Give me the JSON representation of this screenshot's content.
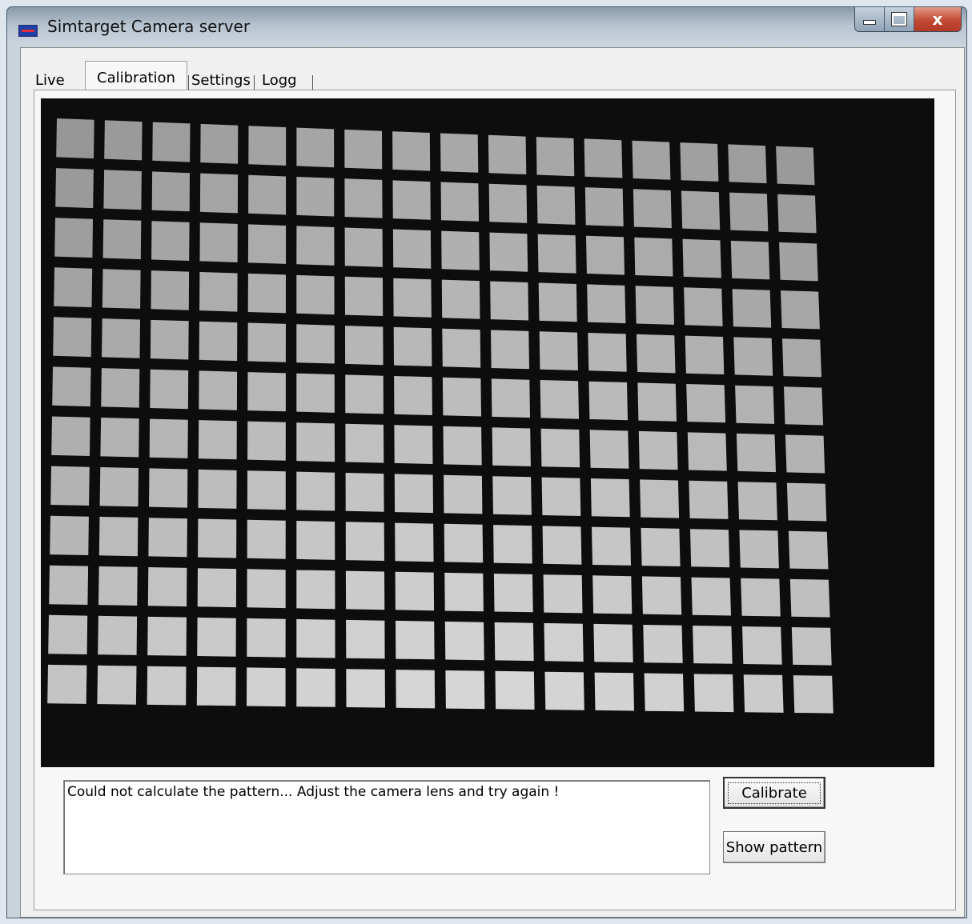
{
  "window": {
    "title": "Simtarget Camera server",
    "icon": "app-icon",
    "caption": {
      "minimize": "minimize-icon",
      "maximize": "maximize-icon",
      "close": "x"
    }
  },
  "tabs": [
    {
      "label": "Live",
      "active": false
    },
    {
      "label": "Calibration",
      "active": true
    },
    {
      "label": "Settings",
      "active": false
    },
    {
      "label": "Logg",
      "active": false
    }
  ],
  "calibration": {
    "status_message": "Could not calculate the pattern... Adjust the camera lens and try again !",
    "calibrate_label": "Calibrate",
    "show_pattern_label": "Show pattern"
  },
  "colors": {
    "preview_background": "#0d0d0d",
    "pattern_square": "#a8a8a8"
  }
}
